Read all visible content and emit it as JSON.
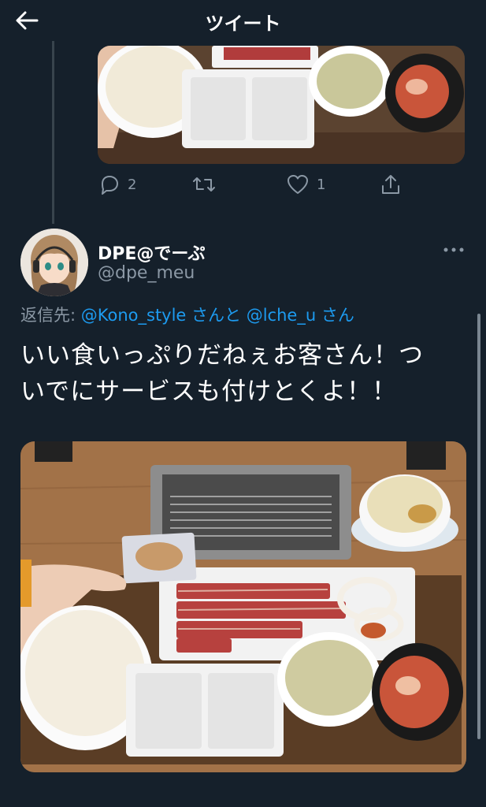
{
  "header": {
    "title": "ツイート",
    "back_icon": "back-arrow-icon"
  },
  "previous_tweet": {
    "photo_alt": "Rice bowl, dipping plates, soup cup and kimchi on a tray",
    "actions": {
      "reply_count": "2",
      "retweet_count": "",
      "like_count": "1"
    }
  },
  "tweet": {
    "author_name": "DPE@でーぷ",
    "author_handle": "@dpe_meu",
    "reply_prefix": "返信先: ",
    "mention_1": "@Kono_style",
    "san_1": " さんと ",
    "mention_2": "@lche_u",
    "san_2": " さん",
    "text_line_1": "いい食いっぷりだねぇお客さん！つ",
    "text_line_2": "いでにサービスも付けとくよ！！",
    "photo_alt": "Yakiniku set with grill, meat, rice, soup, kimchi and a gyoza card held in hand"
  },
  "colors": {
    "background": "#15202b",
    "accent": "#1d9bf0",
    "secondary_text": "#8b98a5"
  }
}
